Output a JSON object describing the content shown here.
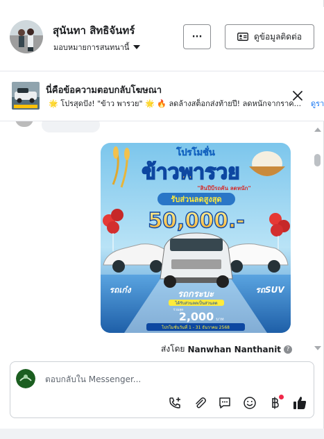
{
  "header": {
    "name": "สุนันทา สิทธิจันทร์",
    "role": "มอบหมายการสนทนานี้",
    "contact_label": "ดูข้อมูลติดต่อ",
    "more_label": "···"
  },
  "ad": {
    "title": "นี่คือข้อความตอบกลับโฆษณา",
    "text": "🌟 โปรสุดปัง! \"ข้าว พารวย\" 🌟 🔥 ลดล้างสต็อกส่งท้ายปี! ลดหนักจากราค...",
    "more": "ดูรา"
  },
  "promo": {
    "headline": "โปรโมชั่น",
    "brand": "ข้าวพารวย",
    "tagline": "\"สินปีบีรถคัน ลดหนัก\"",
    "discount_label": "รับส่วนลดสูงสุด",
    "discount_value": "50,000.-",
    "left_label": "รถเก๋ง",
    "center_label": "รถกระบะ",
    "center_sub": "ได้รับส่วนลดเป็นส่วนลด",
    "center_value_prefix": "ร่วมสุด",
    "center_value": "2,000",
    "center_unit": "บาท",
    "right_label": "รถSUV",
    "date": "โปรโมชั่นวันที่ 1 - 31 ธันวาคม 2568"
  },
  "message": {
    "sent_by_prefix": "ส่งโดย",
    "sender": "Nanwhan Nanthanit",
    "help": "?"
  },
  "composer": {
    "placeholder": "ตอบกลับใน Messenger..."
  },
  "icons": {
    "call": "phone-add-icon",
    "attach": "paperclip-icon",
    "saved": "saved-reply-icon",
    "emoji": "emoji-icon",
    "payment": "baht-icon",
    "like": "thumbs-up-icon"
  },
  "colors": {
    "accent": "#1877f2",
    "notification": "#f02849",
    "text": "#1c1e21"
  }
}
